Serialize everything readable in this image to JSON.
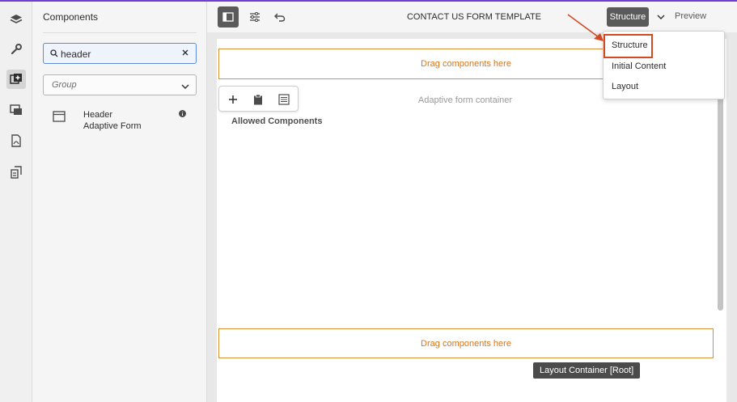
{
  "rail": {
    "icons": [
      "layers-icon",
      "wrench-icon",
      "components-icon",
      "assets-icon",
      "pdf-icon",
      "content-tree-icon"
    ],
    "active_index": 2
  },
  "panel": {
    "title": "Components",
    "search": {
      "value": "header"
    },
    "group": {
      "placeholder": "Group"
    },
    "components": [
      {
        "line1": "Header",
        "line2": "Adaptive Form"
      }
    ]
  },
  "topbar": {
    "title": "CONTACT US FORM TEMPLATE",
    "mode_button": "Structure",
    "preview": "Preview"
  },
  "canvas": {
    "drop_top": "Drag components here",
    "drop_bottom": "Drag components here",
    "container_label": "Adaptive form container",
    "allowed_label": "Allowed Components",
    "tooltip": "Layout Container [Root]"
  },
  "mode_menu": {
    "items": [
      "Structure",
      "Initial Content",
      "Layout"
    ],
    "selected": "Structure"
  },
  "colors": {
    "accent_orange": "#d8761a",
    "highlight_red": "#d24a24",
    "top_line": "#6e3fd6",
    "search_border": "#5b8bd9"
  }
}
